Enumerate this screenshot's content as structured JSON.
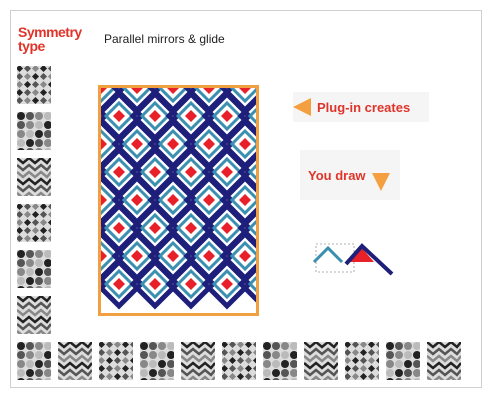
{
  "symmetry_label": "Symmetry\ntype",
  "mode": "Parallel mirrors & glide",
  "hints": {
    "plugin_creates": "Plug-in creates",
    "you_draw": "You draw"
  },
  "icons": {
    "left_arrow": "left-arrow-icon",
    "down_arrow": "down-arrow-icon"
  },
  "colors": {
    "accent": "#e0342a",
    "arrow": "#f5a040",
    "canvas_border": "#f0a040",
    "navy": "#1e1f7a",
    "teal": "#3b8fb0",
    "red": "#e8202a"
  },
  "side_thumbnails": [
    {
      "name": "thumb-scallop"
    },
    {
      "name": "thumb-leaf"
    },
    {
      "name": "thumb-fleur"
    },
    {
      "name": "thumb-figure"
    },
    {
      "name": "thumb-diamond-rows"
    },
    {
      "name": "thumb-zigzag"
    }
  ],
  "bottom_thumbnails": [
    {
      "name": "thumb-meander"
    },
    {
      "name": "thumb-pinwheel"
    },
    {
      "name": "thumb-star"
    },
    {
      "name": "thumb-lattice"
    },
    {
      "name": "thumb-squares"
    },
    {
      "name": "thumb-weave"
    },
    {
      "name": "thumb-tri"
    },
    {
      "name": "thumb-hex"
    },
    {
      "name": "thumb-swirl"
    },
    {
      "name": "thumb-flower"
    },
    {
      "name": "thumb-floral"
    }
  ]
}
